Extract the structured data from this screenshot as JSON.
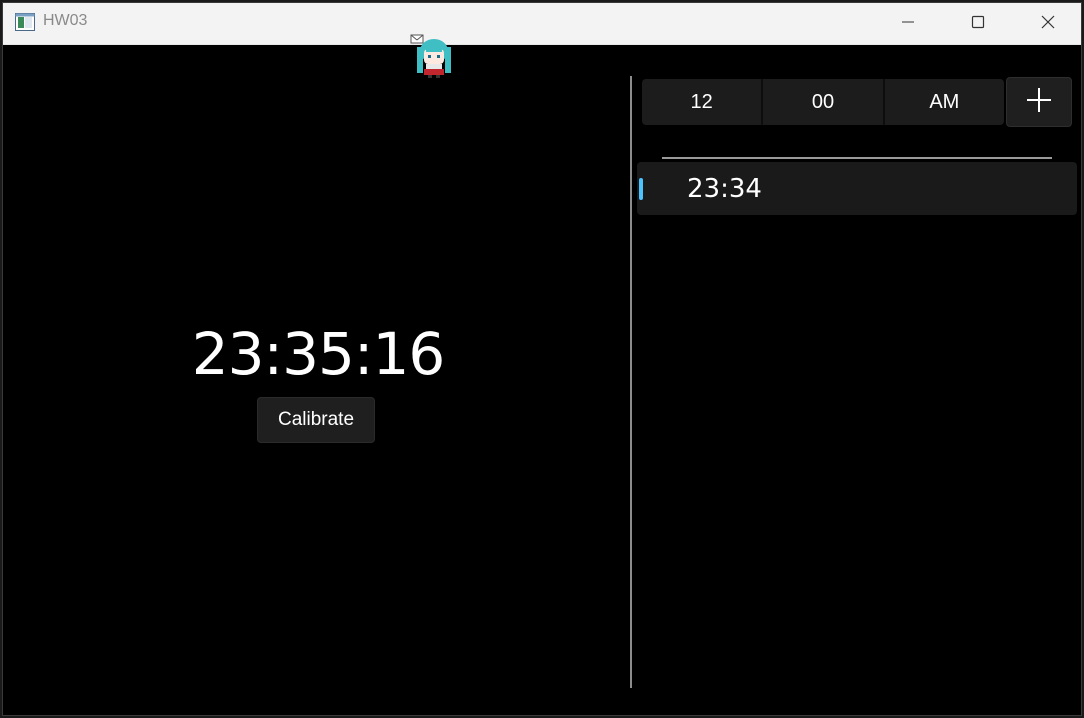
{
  "window": {
    "title": "HW03",
    "app_icon": "app-window-icon",
    "controls": {
      "minimize_icon": "minimize-icon",
      "maximize_icon": "maximize-icon",
      "close_icon": "close-icon"
    }
  },
  "mascot": {
    "icon": "chibi-character-sprite"
  },
  "clock": {
    "time": "23:35:16",
    "calibrate_label": "Calibrate"
  },
  "time_picker": {
    "hour": "12",
    "minute": "00",
    "period": "AM",
    "add_icon": "plus-icon"
  },
  "alarms": [
    {
      "time": "23:34",
      "selected": true
    }
  ],
  "colors": {
    "background": "#000000",
    "titlebar": "#f3f3f3",
    "accent": "#4cc2ff",
    "control_bg": "#1c1c1c",
    "text": "#ffffff"
  }
}
